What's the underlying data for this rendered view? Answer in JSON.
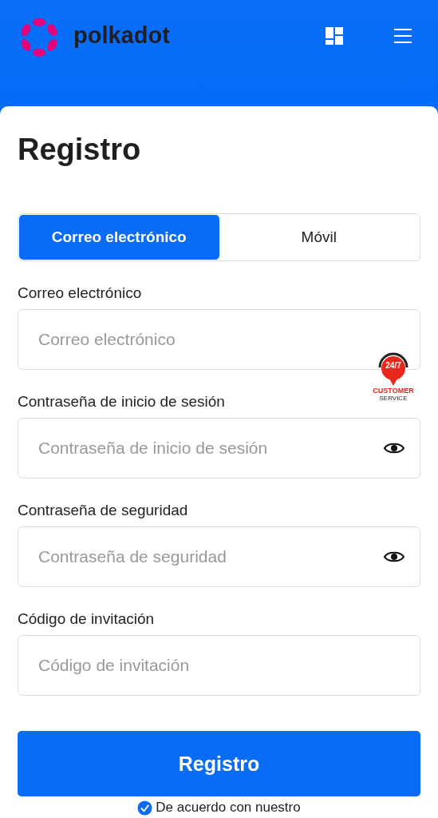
{
  "header": {
    "brand": "polkadot"
  },
  "title": "Registro",
  "tabs": [
    {
      "label": "Correo electrónico",
      "selected": true
    },
    {
      "label": "Móvil",
      "selected": false
    }
  ],
  "fields": [
    {
      "label": "Correo electrónico",
      "placeholder": "Correo electrónico",
      "kind": "text"
    },
    {
      "label": "Contraseña de inicio de sesión",
      "placeholder": "Contraseña de inicio de sesión",
      "kind": "password"
    },
    {
      "label": "Contraseña de seguridad",
      "placeholder": "Contraseña de seguridad",
      "kind": "password"
    },
    {
      "label": "Código de invitación",
      "placeholder": "Código de invitación",
      "kind": "text"
    }
  ],
  "submit": "Registro",
  "agreement": {
    "text": "De acuerdo con nuestro",
    "checked": true
  },
  "support_badge": {
    "hours": "24/7",
    "line1": "CUSTOMER",
    "line2": "SERVICE"
  }
}
